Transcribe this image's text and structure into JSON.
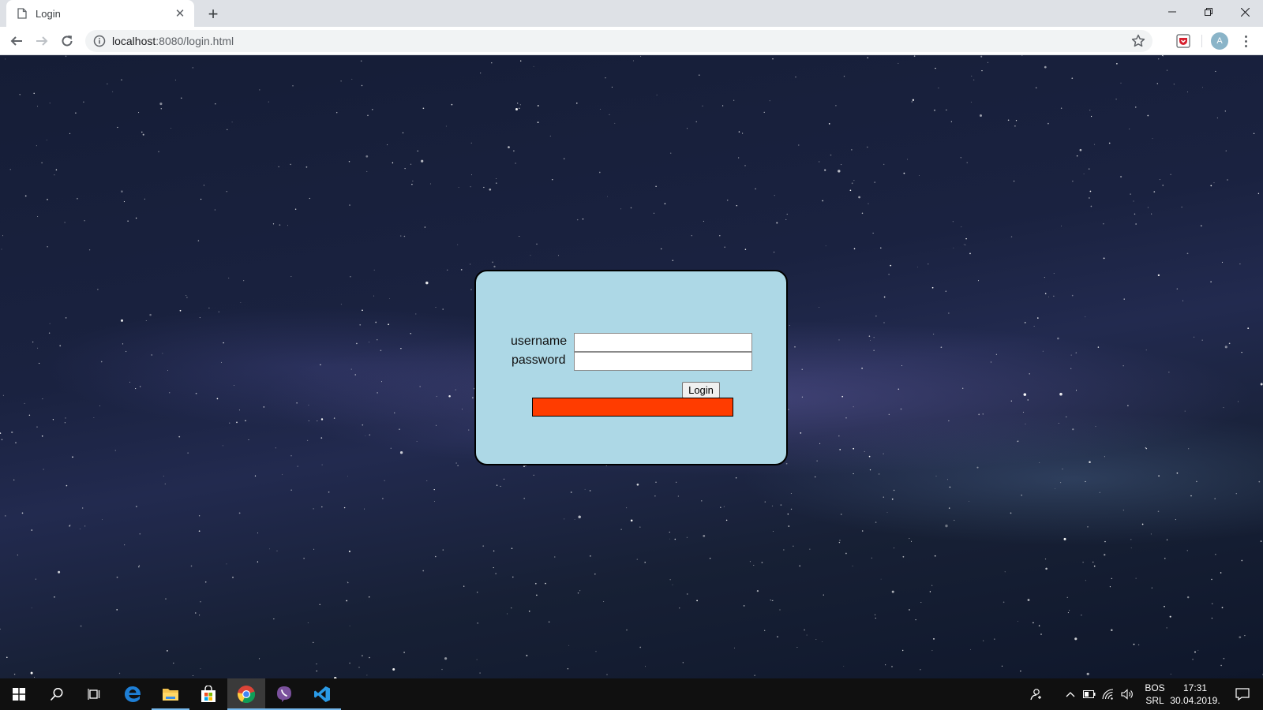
{
  "browser": {
    "tab_title": "Login",
    "url_host": "localhost",
    "url_rest": ":8080/login.html",
    "profile_initial": "A"
  },
  "login_form": {
    "username_label": "username",
    "password_label": "password",
    "username_value": "",
    "password_value": "",
    "login_button_label": "Login",
    "error_bar_color": "#ff3c00",
    "panel_color": "#add8e6"
  },
  "taskbar": {
    "pinned_apps": [
      "start-icon",
      "search-icon",
      "task-view-icon",
      "edge-icon",
      "file-explorer-icon",
      "store-icon",
      "chrome-icon",
      "viber-icon",
      "vscode-icon"
    ],
    "language_top": "BOS",
    "language_bottom": "SRL",
    "time": "17:31",
    "date": "30.04.2019."
  }
}
